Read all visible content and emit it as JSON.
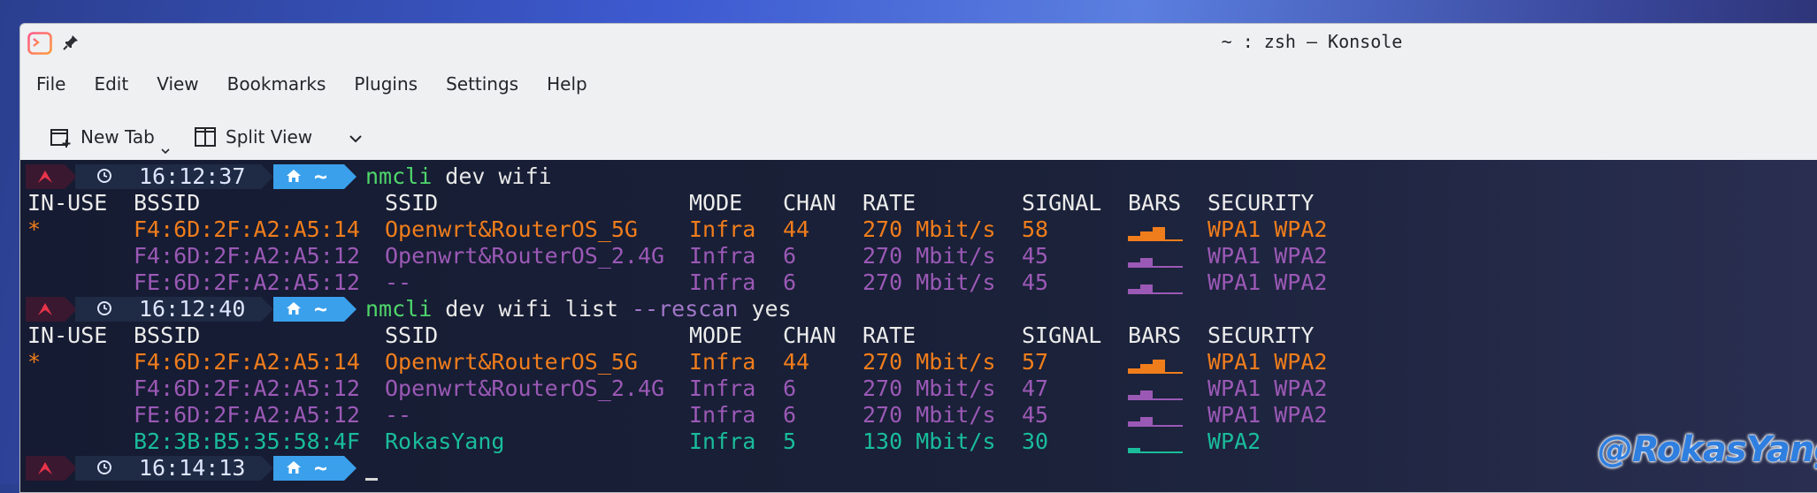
{
  "window": {
    "title": "~ : zsh — Konsole",
    "icons": [
      "konsole-app-icon",
      "pin-icon"
    ]
  },
  "menu": [
    "File",
    "Edit",
    "View",
    "Bookmarks",
    "Plugins",
    "Settings",
    "Help"
  ],
  "toolbar": {
    "new_tab_label": "New Tab",
    "split_view_label": "Split View"
  },
  "prompts": [
    {
      "time": "16:12:37",
      "dir": "~",
      "command": "nmcli",
      "args": " dev wifi",
      "flag": "",
      "flag_val": ""
    },
    {
      "time": "16:12:40",
      "dir": "~",
      "command": "nmcli",
      "args": " dev wifi list ",
      "flag": "--rescan",
      "flag_val": " yes"
    },
    {
      "time": "16:14:13",
      "dir": "~",
      "command": "",
      "args": "",
      "flag": "",
      "flag_val": ""
    }
  ],
  "columns": [
    "IN-USE",
    "BSSID",
    "SSID",
    "MODE",
    "CHAN",
    "RATE",
    "SIGNAL",
    "BARS",
    "SECURITY"
  ],
  "scan1": [
    {
      "in_use": "*",
      "bssid": "F4:6D:2F:A2:A5:14",
      "ssid": "Openwrt&RouterOS_5G",
      "mode": "Infra",
      "chan": "44",
      "rate": "270 Mbit/s",
      "signal": "58",
      "bars": 3,
      "security": "WPA1 WPA2",
      "color": "#f07d1c"
    },
    {
      "in_use": "",
      "bssid": "F4:6D:2F:A2:A5:12",
      "ssid": "Openwrt&RouterOS_2.4G",
      "mode": "Infra",
      "chan": "6",
      "rate": "270 Mbit/s",
      "signal": "45",
      "bars": 2,
      "security": "WPA1 WPA2",
      "color": "#9b59b6"
    },
    {
      "in_use": "",
      "bssid": "FE:6D:2F:A2:A5:12",
      "ssid": "--",
      "mode": "Infra",
      "chan": "6",
      "rate": "270 Mbit/s",
      "signal": "45",
      "bars": 2,
      "security": "WPA1 WPA2",
      "color": "#9b59b6"
    }
  ],
  "scan2": [
    {
      "in_use": "*",
      "bssid": "F4:6D:2F:A2:A5:14",
      "ssid": "Openwrt&RouterOS_5G",
      "mode": "Infra",
      "chan": "44",
      "rate": "270 Mbit/s",
      "signal": "57",
      "bars": 3,
      "security": "WPA1 WPA2",
      "color": "#f07d1c"
    },
    {
      "in_use": "",
      "bssid": "F4:6D:2F:A2:A5:12",
      "ssid": "Openwrt&RouterOS_2.4G",
      "mode": "Infra",
      "chan": "6",
      "rate": "270 Mbit/s",
      "signal": "47",
      "bars": 2,
      "security": "WPA1 WPA2",
      "color": "#9b59b6"
    },
    {
      "in_use": "",
      "bssid": "FE:6D:2F:A2:A5:12",
      "ssid": "--",
      "mode": "Infra",
      "chan": "6",
      "rate": "270 Mbit/s",
      "signal": "45",
      "bars": 2,
      "security": "WPA1 WPA2",
      "color": "#9b59b6"
    },
    {
      "in_use": "",
      "bssid": "B2:3B:B5:35:58:4F",
      "ssid": "RokasYang",
      "mode": "Infra",
      "chan": "5",
      "rate": "130 Mbit/s",
      "signal": "30",
      "bars": 1,
      "security": "WPA2",
      "color": "#1abc9c"
    }
  ],
  "watermark": "@RokasYang",
  "colors": {
    "command_green": "#4fd66b",
    "flag_purple": "#a277c9",
    "prompt_blue": "#3aa0ec",
    "prompt_dark": "#1f2a44",
    "prompt_red": "#e8344a"
  }
}
